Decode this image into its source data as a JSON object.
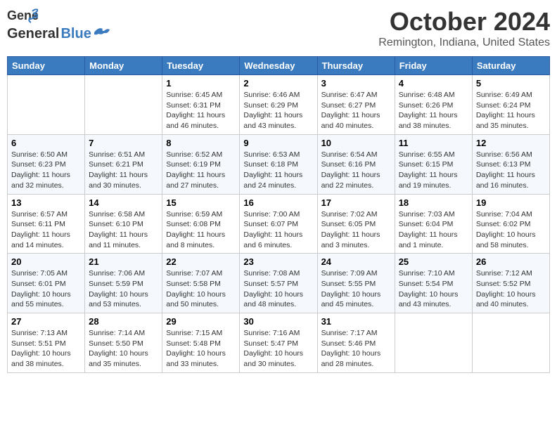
{
  "header": {
    "logo_line1": "General",
    "logo_line2": "Blue",
    "month": "October 2024",
    "location": "Remington, Indiana, United States"
  },
  "days_of_week": [
    "Sunday",
    "Monday",
    "Tuesday",
    "Wednesday",
    "Thursday",
    "Friday",
    "Saturday"
  ],
  "weeks": [
    [
      {
        "day": "",
        "sunrise": "",
        "sunset": "",
        "daylight": ""
      },
      {
        "day": "",
        "sunrise": "",
        "sunset": "",
        "daylight": ""
      },
      {
        "day": "1",
        "sunrise": "Sunrise: 6:45 AM",
        "sunset": "Sunset: 6:31 PM",
        "daylight": "Daylight: 11 hours and 46 minutes."
      },
      {
        "day": "2",
        "sunrise": "Sunrise: 6:46 AM",
        "sunset": "Sunset: 6:29 PM",
        "daylight": "Daylight: 11 hours and 43 minutes."
      },
      {
        "day": "3",
        "sunrise": "Sunrise: 6:47 AM",
        "sunset": "Sunset: 6:27 PM",
        "daylight": "Daylight: 11 hours and 40 minutes."
      },
      {
        "day": "4",
        "sunrise": "Sunrise: 6:48 AM",
        "sunset": "Sunset: 6:26 PM",
        "daylight": "Daylight: 11 hours and 38 minutes."
      },
      {
        "day": "5",
        "sunrise": "Sunrise: 6:49 AM",
        "sunset": "Sunset: 6:24 PM",
        "daylight": "Daylight: 11 hours and 35 minutes."
      }
    ],
    [
      {
        "day": "6",
        "sunrise": "Sunrise: 6:50 AM",
        "sunset": "Sunset: 6:23 PM",
        "daylight": "Daylight: 11 hours and 32 minutes."
      },
      {
        "day": "7",
        "sunrise": "Sunrise: 6:51 AM",
        "sunset": "Sunset: 6:21 PM",
        "daylight": "Daylight: 11 hours and 30 minutes."
      },
      {
        "day": "8",
        "sunrise": "Sunrise: 6:52 AM",
        "sunset": "Sunset: 6:19 PM",
        "daylight": "Daylight: 11 hours and 27 minutes."
      },
      {
        "day": "9",
        "sunrise": "Sunrise: 6:53 AM",
        "sunset": "Sunset: 6:18 PM",
        "daylight": "Daylight: 11 hours and 24 minutes."
      },
      {
        "day": "10",
        "sunrise": "Sunrise: 6:54 AM",
        "sunset": "Sunset: 6:16 PM",
        "daylight": "Daylight: 11 hours and 22 minutes."
      },
      {
        "day": "11",
        "sunrise": "Sunrise: 6:55 AM",
        "sunset": "Sunset: 6:15 PM",
        "daylight": "Daylight: 11 hours and 19 minutes."
      },
      {
        "day": "12",
        "sunrise": "Sunrise: 6:56 AM",
        "sunset": "Sunset: 6:13 PM",
        "daylight": "Daylight: 11 hours and 16 minutes."
      }
    ],
    [
      {
        "day": "13",
        "sunrise": "Sunrise: 6:57 AM",
        "sunset": "Sunset: 6:11 PM",
        "daylight": "Daylight: 11 hours and 14 minutes."
      },
      {
        "day": "14",
        "sunrise": "Sunrise: 6:58 AM",
        "sunset": "Sunset: 6:10 PM",
        "daylight": "Daylight: 11 hours and 11 minutes."
      },
      {
        "day": "15",
        "sunrise": "Sunrise: 6:59 AM",
        "sunset": "Sunset: 6:08 PM",
        "daylight": "Daylight: 11 hours and 8 minutes."
      },
      {
        "day": "16",
        "sunrise": "Sunrise: 7:00 AM",
        "sunset": "Sunset: 6:07 PM",
        "daylight": "Daylight: 11 hours and 6 minutes."
      },
      {
        "day": "17",
        "sunrise": "Sunrise: 7:02 AM",
        "sunset": "Sunset: 6:05 PM",
        "daylight": "Daylight: 11 hours and 3 minutes."
      },
      {
        "day": "18",
        "sunrise": "Sunrise: 7:03 AM",
        "sunset": "Sunset: 6:04 PM",
        "daylight": "Daylight: 11 hours and 1 minute."
      },
      {
        "day": "19",
        "sunrise": "Sunrise: 7:04 AM",
        "sunset": "Sunset: 6:02 PM",
        "daylight": "Daylight: 10 hours and 58 minutes."
      }
    ],
    [
      {
        "day": "20",
        "sunrise": "Sunrise: 7:05 AM",
        "sunset": "Sunset: 6:01 PM",
        "daylight": "Daylight: 10 hours and 55 minutes."
      },
      {
        "day": "21",
        "sunrise": "Sunrise: 7:06 AM",
        "sunset": "Sunset: 5:59 PM",
        "daylight": "Daylight: 10 hours and 53 minutes."
      },
      {
        "day": "22",
        "sunrise": "Sunrise: 7:07 AM",
        "sunset": "Sunset: 5:58 PM",
        "daylight": "Daylight: 10 hours and 50 minutes."
      },
      {
        "day": "23",
        "sunrise": "Sunrise: 7:08 AM",
        "sunset": "Sunset: 5:57 PM",
        "daylight": "Daylight: 10 hours and 48 minutes."
      },
      {
        "day": "24",
        "sunrise": "Sunrise: 7:09 AM",
        "sunset": "Sunset: 5:55 PM",
        "daylight": "Daylight: 10 hours and 45 minutes."
      },
      {
        "day": "25",
        "sunrise": "Sunrise: 7:10 AM",
        "sunset": "Sunset: 5:54 PM",
        "daylight": "Daylight: 10 hours and 43 minutes."
      },
      {
        "day": "26",
        "sunrise": "Sunrise: 7:12 AM",
        "sunset": "Sunset: 5:52 PM",
        "daylight": "Daylight: 10 hours and 40 minutes."
      }
    ],
    [
      {
        "day": "27",
        "sunrise": "Sunrise: 7:13 AM",
        "sunset": "Sunset: 5:51 PM",
        "daylight": "Daylight: 10 hours and 38 minutes."
      },
      {
        "day": "28",
        "sunrise": "Sunrise: 7:14 AM",
        "sunset": "Sunset: 5:50 PM",
        "daylight": "Daylight: 10 hours and 35 minutes."
      },
      {
        "day": "29",
        "sunrise": "Sunrise: 7:15 AM",
        "sunset": "Sunset: 5:48 PM",
        "daylight": "Daylight: 10 hours and 33 minutes."
      },
      {
        "day": "30",
        "sunrise": "Sunrise: 7:16 AM",
        "sunset": "Sunset: 5:47 PM",
        "daylight": "Daylight: 10 hours and 30 minutes."
      },
      {
        "day": "31",
        "sunrise": "Sunrise: 7:17 AM",
        "sunset": "Sunset: 5:46 PM",
        "daylight": "Daylight: 10 hours and 28 minutes."
      },
      {
        "day": "",
        "sunrise": "",
        "sunset": "",
        "daylight": ""
      },
      {
        "day": "",
        "sunrise": "",
        "sunset": "",
        "daylight": ""
      }
    ]
  ]
}
